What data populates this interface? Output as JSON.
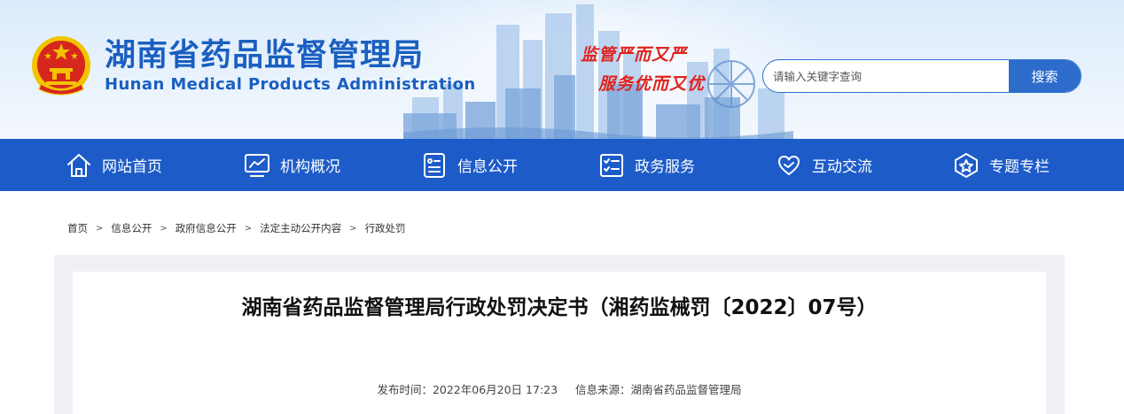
{
  "header": {
    "title": "湖南省药品监督管理局",
    "subtitle": "Hunan Medical Products Administration",
    "slogan_line1": "监管严而又严",
    "slogan_line2": "服务优而又优",
    "emblem_icon": "national-emblem-icon"
  },
  "search": {
    "placeholder": "请输入关键字查询",
    "button_label": "搜索"
  },
  "nav": {
    "items": [
      {
        "label": "网站首页",
        "icon": "home-icon"
      },
      {
        "label": "机构概况",
        "icon": "monitor-chart-icon"
      },
      {
        "label": "信息公开",
        "icon": "document-list-icon"
      },
      {
        "label": "政务服务",
        "icon": "checklist-icon"
      },
      {
        "label": "互动交流",
        "icon": "heart-hands-icon"
      },
      {
        "label": "专题专栏",
        "icon": "star-badge-icon"
      }
    ]
  },
  "breadcrumb": [
    "首页",
    "信息公开",
    "政府信息公开",
    "法定主动公开内容",
    "行政处罚"
  ],
  "article": {
    "title": "湖南省药品监督管理局行政处罚决定书（湘药监械罚〔2022〕07号）",
    "publish_time": "发布时间：2022年06月20日 17:23",
    "source": "信息来源：湖南省药品监督管理局"
  },
  "colors": {
    "brand_blue": "#1d5cc8",
    "title_blue": "#1a5fc0",
    "slogan_red": "#e0231e",
    "emblem_red": "#d7261e",
    "emblem_gold": "#f3c300"
  }
}
